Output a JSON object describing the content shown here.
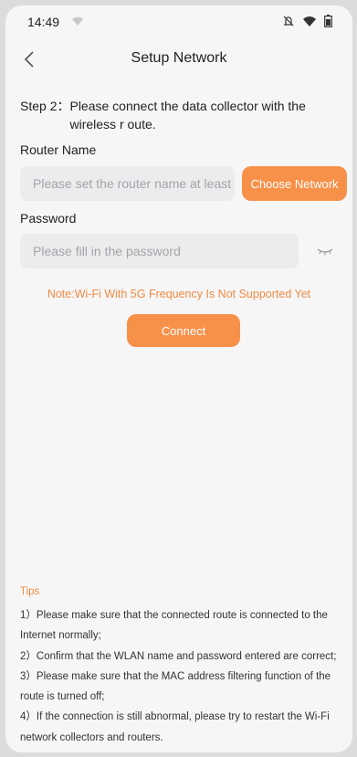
{
  "status_bar": {
    "time": "14:49"
  },
  "header": {
    "title": "Setup Network"
  },
  "step": {
    "prefix": "Step 2：",
    "text": "Please connect the data collector with the wireless r oute."
  },
  "router": {
    "label": "Router Name",
    "placeholder": "Please set the router name at least",
    "choose_button": "Choose Network"
  },
  "password": {
    "label": "Password",
    "placeholder": "Please fill in the password"
  },
  "note": "Note:Wi-Fi With 5G Frequency Is Not Supported Yet",
  "connect_button": "Connect",
  "tips": {
    "title": "Tips",
    "items": [
      "1）Please make sure that the connected route is connected to the Internet normally;",
      "2）Confirm that the WLAN name and password entered are correct;",
      "3）Please make sure that the MAC address filtering function of the route is turned off;",
      "4）If the connection is still abnormal, please try to restart the Wi-Fi network collectors and routers."
    ]
  },
  "colors": {
    "accent": "#f7914a",
    "note": "#f08a40",
    "input_bg": "#ececef",
    "screen_bg": "#f6f6f7"
  },
  "icons": [
    "wifi-status-icon",
    "mute-icon",
    "signal-icon",
    "battery-icon",
    "back-arrow-icon",
    "eye-closed-icon"
  ]
}
